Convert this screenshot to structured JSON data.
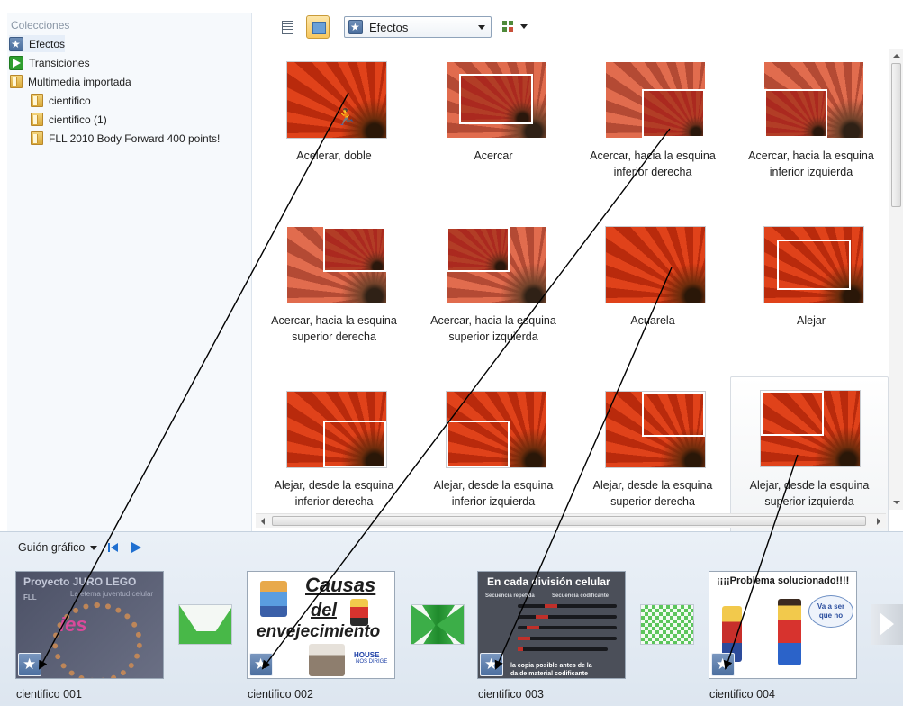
{
  "sidebar": {
    "heading": "Colecciones",
    "items": [
      {
        "label": "Efectos",
        "icon": "star-icon"
      },
      {
        "label": "Transiciones",
        "icon": "play-icon"
      },
      {
        "label": "Multimedia importada",
        "icon": "folder-icon"
      },
      {
        "label": "cientifico",
        "icon": "folder-icon"
      },
      {
        "label": "cientifico (1)",
        "icon": "folder-icon"
      },
      {
        "label": "FLL 2010 Body Forward 400 points!",
        "icon": "folder-icon"
      }
    ]
  },
  "toolbar": {
    "view_list_icon": "list-view-icon",
    "view_thumb_icon": "thumbnail-view-icon",
    "dropdown_value": "Efectos",
    "arrange_icon": "arrange-icon"
  },
  "effects": [
    {
      "caption": "Acelerar, doble"
    },
    {
      "caption": "Acercar"
    },
    {
      "caption": "Acercar, hacia la esquina inferior derecha"
    },
    {
      "caption": "Acercar, hacia la esquina inferior izquierda"
    },
    {
      "caption": "Acercar, hacia la esquina superior derecha"
    },
    {
      "caption": "Acercar, hacia la esquina superior izquierda"
    },
    {
      "caption": "Acuarela"
    },
    {
      "caption": "Alejar"
    },
    {
      "caption": "Alejar, desde la esquina inferior derecha"
    },
    {
      "caption": "Alejar, desde la esquina inferior izquierda"
    },
    {
      "caption": "Alejar, desde la esquina superior derecha"
    },
    {
      "caption": "Alejar, desde la esquina superior izquierda"
    }
  ],
  "storyboard": {
    "title": "Guión gráfico",
    "clips": [
      {
        "label": "cientifico 001",
        "slide": {
          "title": "Proyecto JURO LEGO",
          "subtitle": "La eterna juventud celular",
          "logo": "FLL",
          "brand": "ies"
        }
      },
      {
        "label": "cientifico 002",
        "slide": {
          "line1": "Causas",
          "line2": "del",
          "line3": "envejecimiento",
          "house": "HOUSE",
          "house_sub": "NOS DIRIGE"
        }
      },
      {
        "label": "cientifico 003",
        "slide": {
          "title": "En cada división celular",
          "col1": "Secuencia repetida",
          "col2": "Secuencia codificante",
          "footer1": "la copia posible antes de la",
          "footer2": "da de material codificante"
        }
      },
      {
        "label": "cientifico 004",
        "slide": {
          "title": "¡¡¡¡Problema solucionado!!!!",
          "bubble1": "Va a ser",
          "bubble2": "que no"
        }
      }
    ],
    "transitions": [
      "transition-wedge",
      "transition-bowtie",
      "transition-checker"
    ]
  },
  "colors": {
    "accent": "#1f6fd0",
    "arrow": "#000000",
    "selection": "#f7c75e"
  }
}
